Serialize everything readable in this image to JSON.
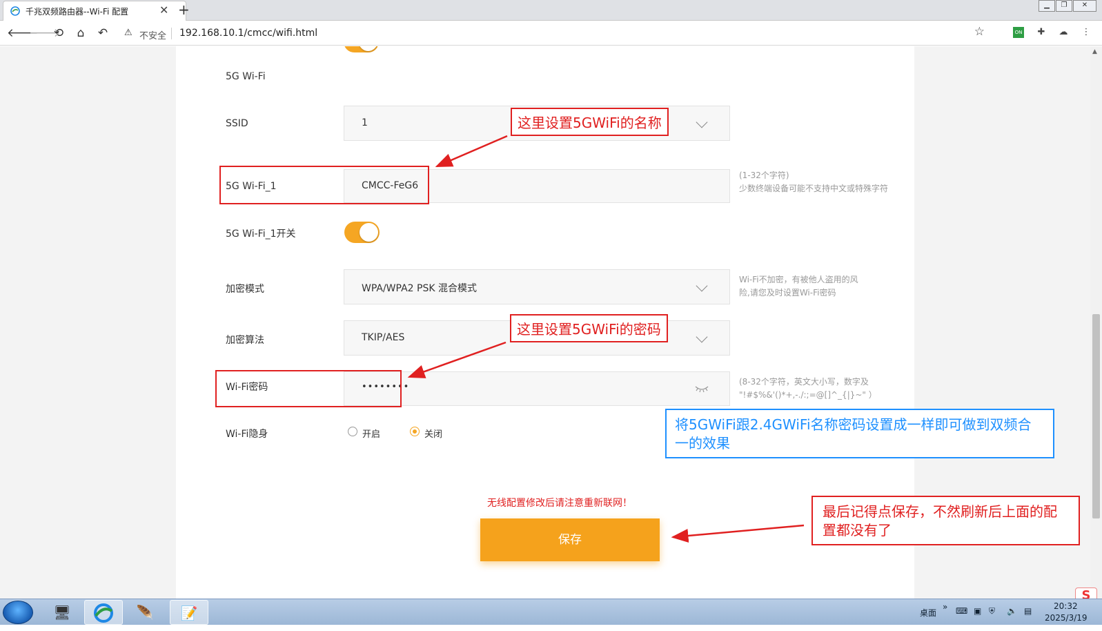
{
  "browser": {
    "tab_title": "千兆双频路由器--Wi-Fi 配置",
    "tab_close": "✕",
    "new_tab": "+",
    "security_label": "不安全",
    "url": "192.168.10.1/cmcc/wifi.html"
  },
  "form": {
    "section_5g": "5G Wi-Fi",
    "ssid_label": "SSID",
    "ssid_value": "1",
    "wifi_name_label": "5G Wi-Fi_1",
    "wifi_name_value": "CMCC-FeG6",
    "wifi_name_hint_1": "(1-32个字符)",
    "wifi_name_hint_2": "少数终端设备可能不支持中文或特殊字符",
    "switch_label": "5G Wi-Fi_1开关",
    "switch_on": true,
    "encrypt_mode_label": "加密模式",
    "encrypt_mode_value": "WPA/WPA2 PSK 混合模式",
    "encrypt_hint_1": "Wi-Fi不加密，有被他人盗用的风",
    "encrypt_hint_2": "险,请您及时设置Wi-Fi密码",
    "algorithm_label": "加密算法",
    "algorithm_value": "TKIP/AES",
    "password_label": "Wi-Fi密码",
    "password_value": "••••••••",
    "password_hint_1": "(8-32个字符，英文大小写，数字及",
    "password_hint_2": " \"!#$%&'()*+,-./:;=@[]^_{|}~\" ）",
    "hidden_label": "Wi-Fi隐身",
    "hidden_on_label": "开启",
    "hidden_off_label": "关闭",
    "hidden_selected": "关闭",
    "notice": "无线配置修改后请注意重新联网！",
    "save_label": "保存"
  },
  "annotations": {
    "name_callout": "这里设置5GWiFi的名称",
    "password_callout": "这里设置5GWiFi的密码",
    "tip_line1": "将5GWiFi跟2.4GWiFi名称密码设置成一样即可做到双频合",
    "tip_line2": "一的效果",
    "save_line1": "最后记得点保存，不然刷新后上面的配",
    "save_line2": "置都没有了"
  },
  "taskbar": {
    "desktop_label": "桌面",
    "time": "20:32",
    "date": "2025/3/19"
  },
  "colors": {
    "accent": "#f5a623",
    "annotation_red": "#e02020",
    "annotation_blue": "#1e90ff"
  }
}
